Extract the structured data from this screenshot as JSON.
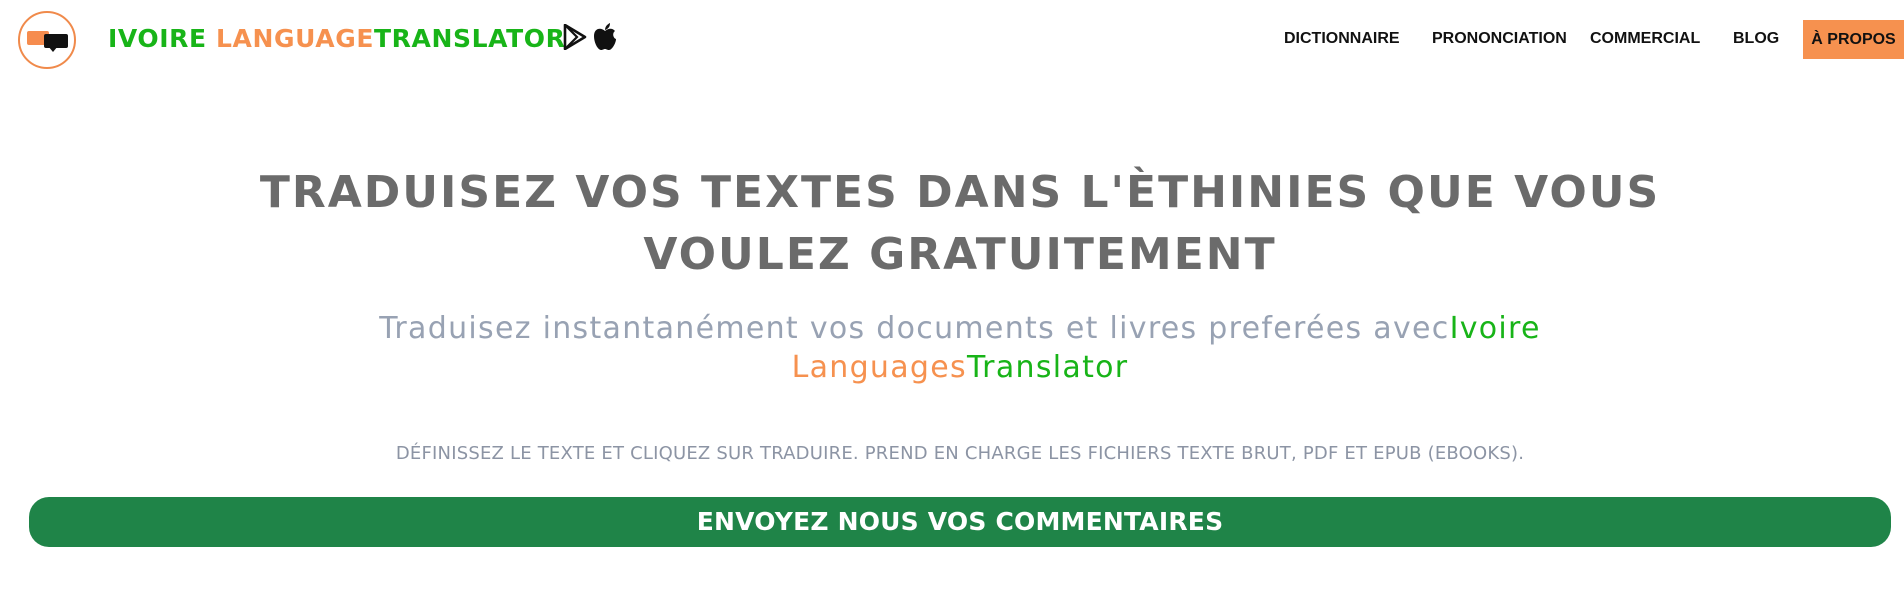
{
  "brand": {
    "part1": "IVOIRE ",
    "part2": "LANGUAGE",
    "part3": "TRANSLATOR",
    "logo_icon": "speech-bubbles-logo"
  },
  "store_icons": [
    "google-play-icon",
    "apple-icon"
  ],
  "nav": {
    "items": [
      "DICTIONNAIRE",
      "PRONONCIATION",
      "COMMERCIAL",
      "BLOG"
    ],
    "active": "À PROPOS"
  },
  "hero": {
    "title_line1": "TRADUISEZ VOS TEXTES DANS L'ÈTHINIES QUE VOUS",
    "title_line2": "VOULEZ GRATUITEMENT",
    "subtitle_prefix": "Traduisez instantanément vos documents et livres preferées avec",
    "subtitle_brand1": "Ivoire",
    "subtitle_brand2": "Languages",
    "subtitle_brand3": "Translator",
    "note": "DÉFINISSEZ LE TEXTE ET CLIQUEZ SUR TRADUIRE. PREND EN CHARGE LES FICHIERS TEXTE BRUT, PDF ET EPUB (EBOOKS).",
    "cta": "ENVOYEZ NOUS VOS COMMENTAIRES"
  },
  "colors": {
    "green": "#18b418",
    "orange": "#f6914f",
    "cta_bg": "#1f8448",
    "title": "#6b6b6b",
    "subtitle": "#98a2b3"
  }
}
